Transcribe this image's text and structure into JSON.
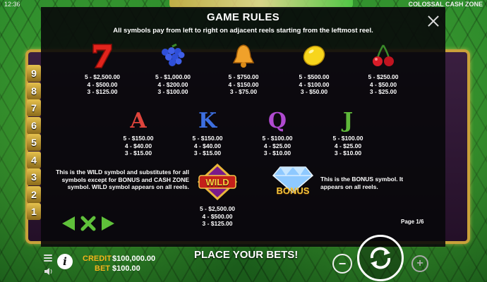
{
  "status_bar": {
    "clock": "12:36",
    "game_title": "COLOSSAL CASH ZONE"
  },
  "lines": [
    "9",
    "8",
    "7",
    "6",
    "5",
    "4",
    "3",
    "2",
    "1"
  ],
  "modal": {
    "title": "GAME RULES",
    "subtitle": "All symbols pay from left to right on adjacent reels starting from the leftmost reel.",
    "page": "Page 1/6",
    "symbols_row1": [
      {
        "icon": "seven-icon",
        "pays": [
          "5 - $2,500.00",
          "4 - $500.00",
          "3 - $125.00"
        ]
      },
      {
        "icon": "grapes-icon",
        "pays": [
          "5 - $1,000.00",
          "4 - $200.00",
          "3 - $100.00"
        ]
      },
      {
        "icon": "bell-icon",
        "pays": [
          "5 - $750.00",
          "4 - $150.00",
          "3 - $75.00"
        ]
      },
      {
        "icon": "lemon-icon",
        "pays": [
          "5 - $500.00",
          "4 - $100.00",
          "3 - $50.00"
        ]
      },
      {
        "icon": "cherries-icon",
        "pays": [
          "5 - $250.00",
          "4 - $50.00",
          "3 - $25.00"
        ]
      }
    ],
    "symbols_row2": [
      {
        "icon": "letter-a-icon",
        "letter": "A",
        "color": "#e0443c",
        "pays": [
          "5 - $150.00",
          "4 - $40.00",
          "3 - $15.00"
        ]
      },
      {
        "icon": "letter-k-icon",
        "letter": "K",
        "color": "#3d6fe0",
        "pays": [
          "5 - $150.00",
          "4 - $40.00",
          "3 - $15.00"
        ]
      },
      {
        "icon": "letter-q-icon",
        "letter": "Q",
        "color": "#b04ad0",
        "pays": [
          "5 - $100.00",
          "4 - $25.00",
          "3 - $10.00"
        ]
      },
      {
        "icon": "letter-j-icon",
        "letter": "J",
        "color": "#5fb83a",
        "pays": [
          "5 - $100.00",
          "4 - $25.00",
          "3 - $10.00"
        ]
      }
    ],
    "wild": {
      "icon": "wild-icon",
      "label": "WILD",
      "description": "This is the WILD symbol and substitutes for all symbols except for BONUS and CASH ZONE symbol. WILD symbol appears on all reels.",
      "pays": [
        "5 - $2,500.00",
        "4 - $500.00",
        "3 - $125.00"
      ]
    },
    "bonus": {
      "icon": "bonus-diamond-icon",
      "label": "BONUS",
      "description": "This is the BONUS symbol. It appears on all reels."
    }
  },
  "bottom": {
    "credit_label": "CREDIT",
    "credit_value": "$100,000.00",
    "bet_label": "BET",
    "bet_value": "$100.00",
    "message": "PLACE YOUR BETS!",
    "minus": "−",
    "plus": "+"
  },
  "colors": {
    "accent_gold": "#f3b31b",
    "nav_green": "#5fc03a"
  }
}
